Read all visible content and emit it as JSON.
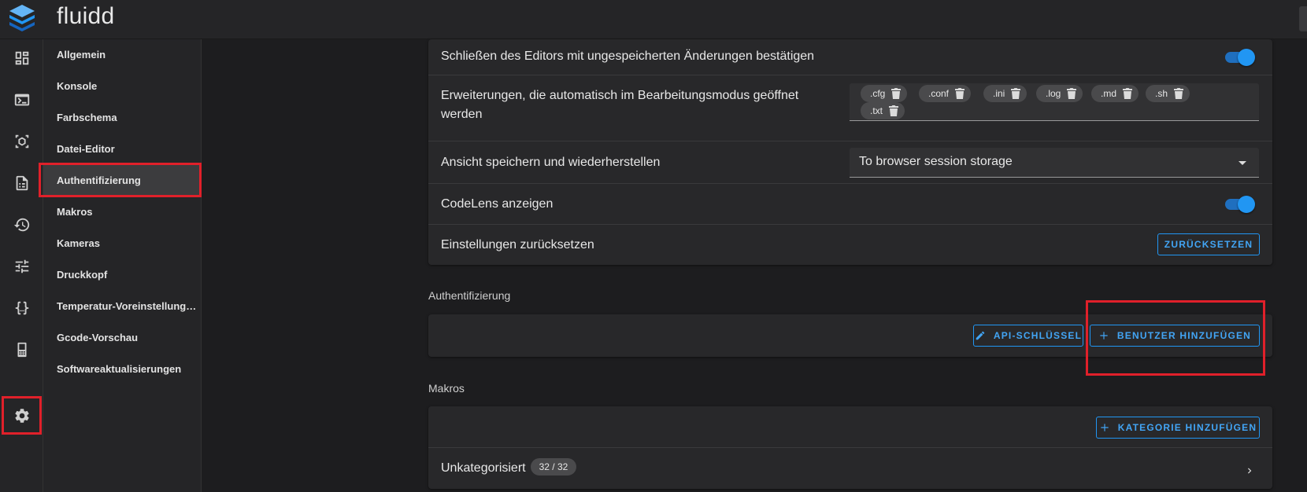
{
  "app": {
    "title": "fluidd",
    "brand_color": "#2196f3",
    "alert_color": "#e0202a"
  },
  "rail": {
    "items": [
      {
        "name": "dashboard-icon"
      },
      {
        "name": "console-icon"
      },
      {
        "name": "jobs-icon"
      },
      {
        "name": "files-icon"
      },
      {
        "name": "history-icon"
      },
      {
        "name": "tune-icon"
      },
      {
        "name": "code-braces-icon"
      },
      {
        "name": "system-icon"
      },
      {
        "name": "gear-icon"
      }
    ]
  },
  "subnav": {
    "items": [
      {
        "label": "Allgemein"
      },
      {
        "label": "Konsole"
      },
      {
        "label": "Farbschema"
      },
      {
        "label": "Datei-Editor"
      },
      {
        "label": "Authentifizierung"
      },
      {
        "label": "Makros"
      },
      {
        "label": "Kameras"
      },
      {
        "label": "Druckkopf"
      },
      {
        "label": "Temperatur-Voreinstellung…"
      },
      {
        "label": "Gcode-Vorschau"
      },
      {
        "label": "Softwareaktualisierungen"
      }
    ],
    "active_index": 4
  },
  "editor": {
    "confirm_close": {
      "label": "Schließen des Editors mit ungespeicherten Änderungen bestätigen",
      "enabled": true
    },
    "extensions": {
      "label_line1": "Erweiterungen, die automatisch im Bearbeitungsmodus geöffnet",
      "label_line2": "werden",
      "chips": [
        ".cfg",
        ".conf",
        ".ini",
        ".log",
        ".md",
        ".sh",
        ".txt"
      ]
    },
    "view_state": {
      "label": "Ansicht speichern und wiederherstellen",
      "value": "To browser session storage"
    },
    "codelens": {
      "label": "CodeLens anzeigen",
      "enabled": true
    },
    "reset": {
      "label": "Einstellungen zurücksetzen",
      "button": "ZURÜCKSETZEN"
    }
  },
  "auth": {
    "title": "Authentifizierung",
    "api_key_button": "API-SCHLÜSSEL",
    "add_user_button": "BENUTZER HINZUFÜGEN"
  },
  "macros": {
    "title": "Makros",
    "add_category_button": "KATEGORIE HINZUFÜGEN",
    "uncategorized": {
      "label": "Unkategorisiert",
      "count": "32 / 32"
    }
  }
}
